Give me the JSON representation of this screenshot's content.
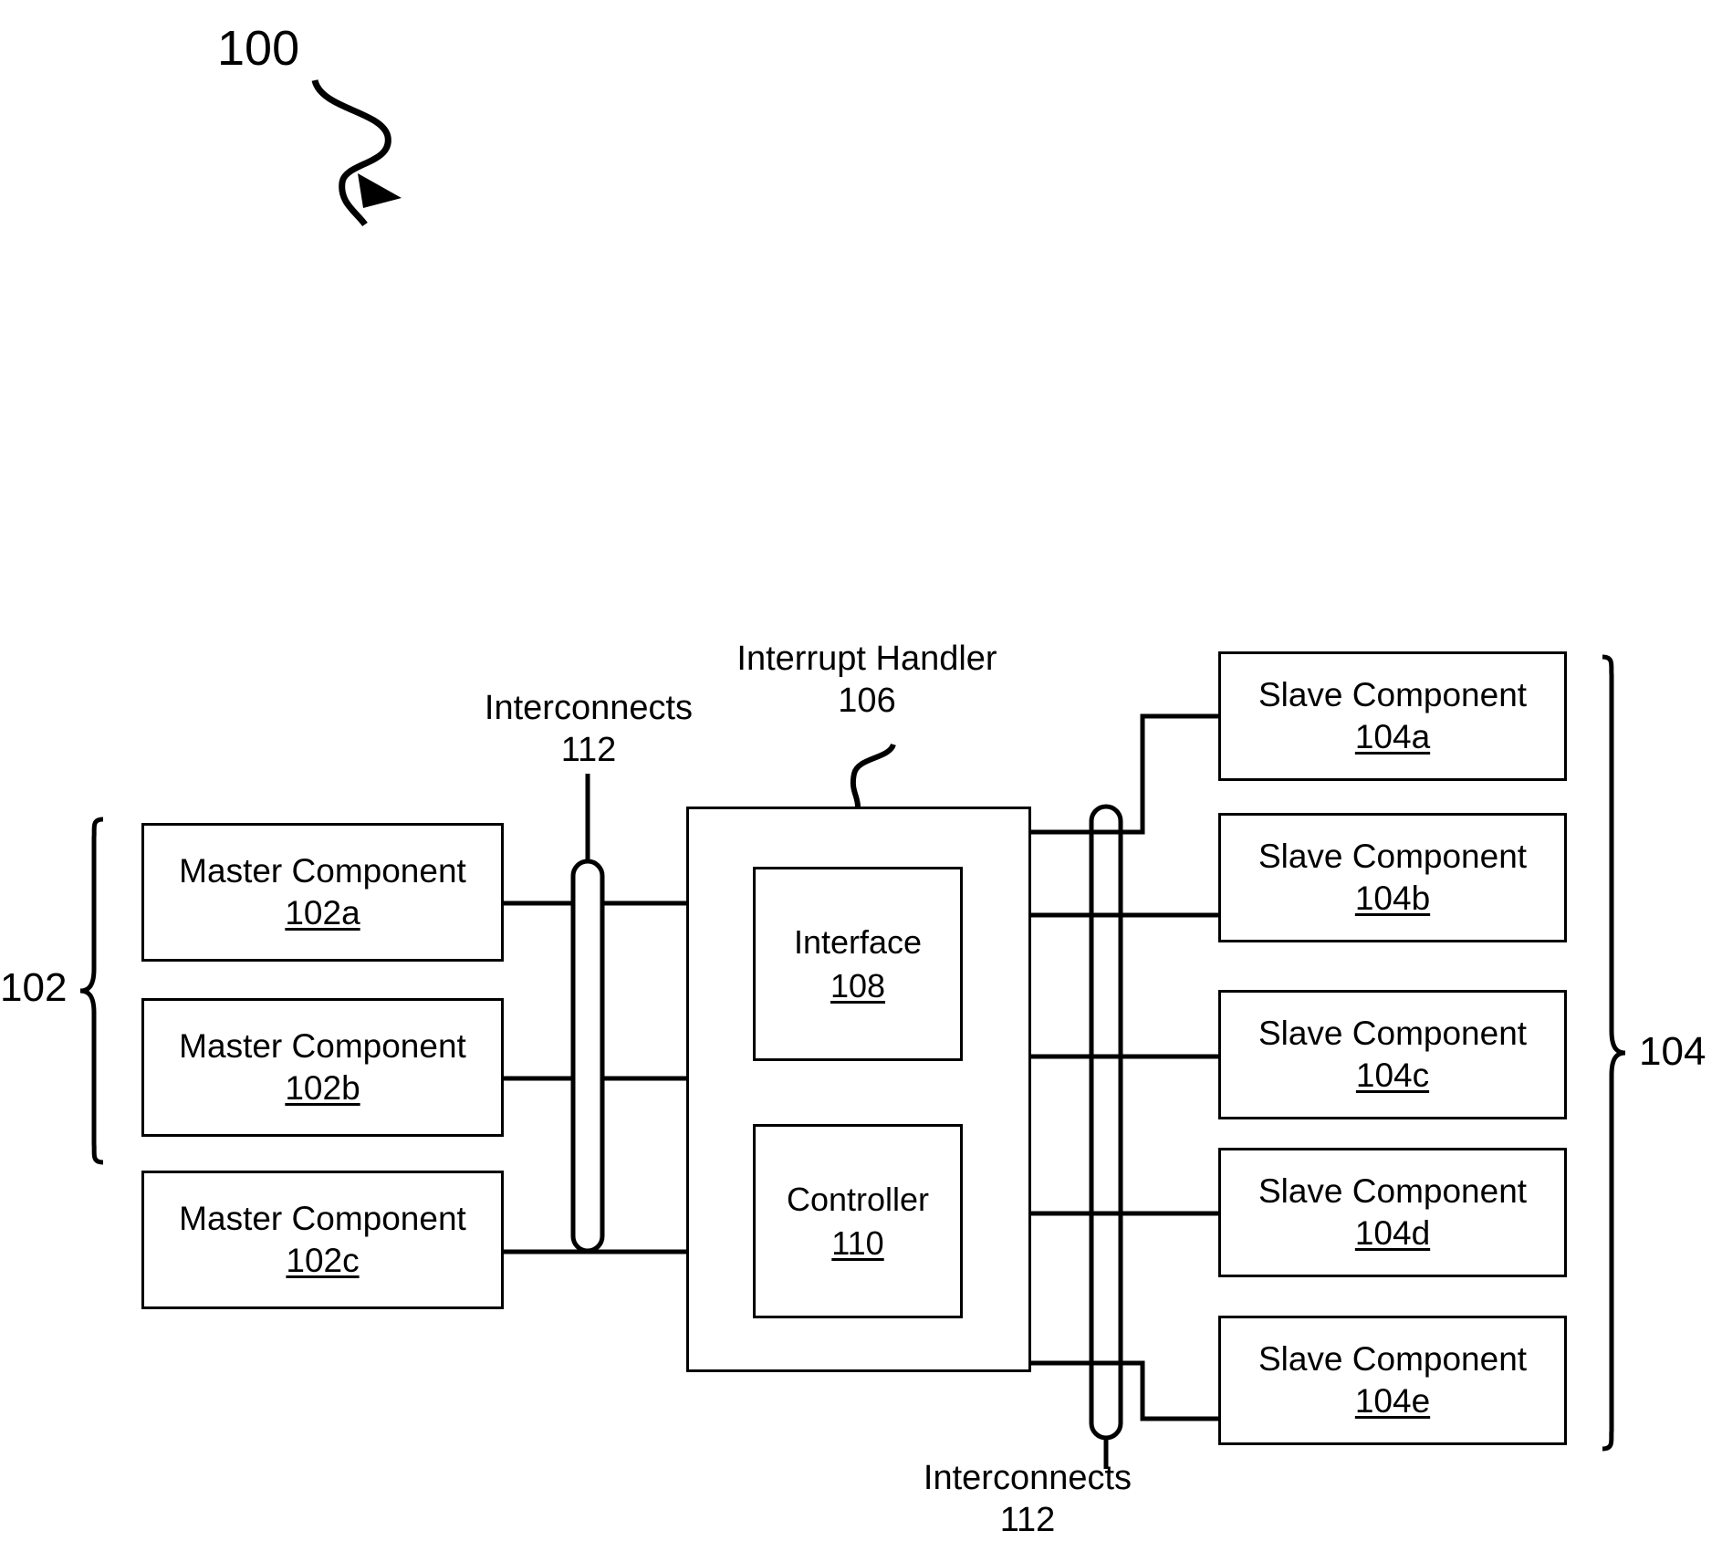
{
  "figure": {
    "figure_ref": "100",
    "master_group_ref": "102",
    "slave_group_ref": "104"
  },
  "masters": [
    {
      "title": "Master Component",
      "ref": "102a"
    },
    {
      "title": "Master Component",
      "ref": "102b"
    },
    {
      "title": "Master Component",
      "ref": "102c"
    }
  ],
  "slaves": [
    {
      "title": "Slave Component",
      "ref": "104a"
    },
    {
      "title": "Slave Component",
      "ref": "104b"
    },
    {
      "title": "Slave Component",
      "ref": "104c"
    },
    {
      "title": "Slave Component",
      "ref": "104d"
    },
    {
      "title": "Slave Component",
      "ref": "104e"
    }
  ],
  "handler": {
    "title": "Interrupt Handler",
    "ref": "106",
    "interface": {
      "title": "Interface",
      "ref": "108"
    },
    "controller": {
      "title": "Controller",
      "ref": "110"
    }
  },
  "interconnects_left": {
    "title": "Interconnects",
    "ref": "112"
  },
  "interconnects_right": {
    "title": "Interconnects",
    "ref": "112"
  },
  "colors": {
    "stroke": "#000000",
    "background": "#ffffff"
  }
}
